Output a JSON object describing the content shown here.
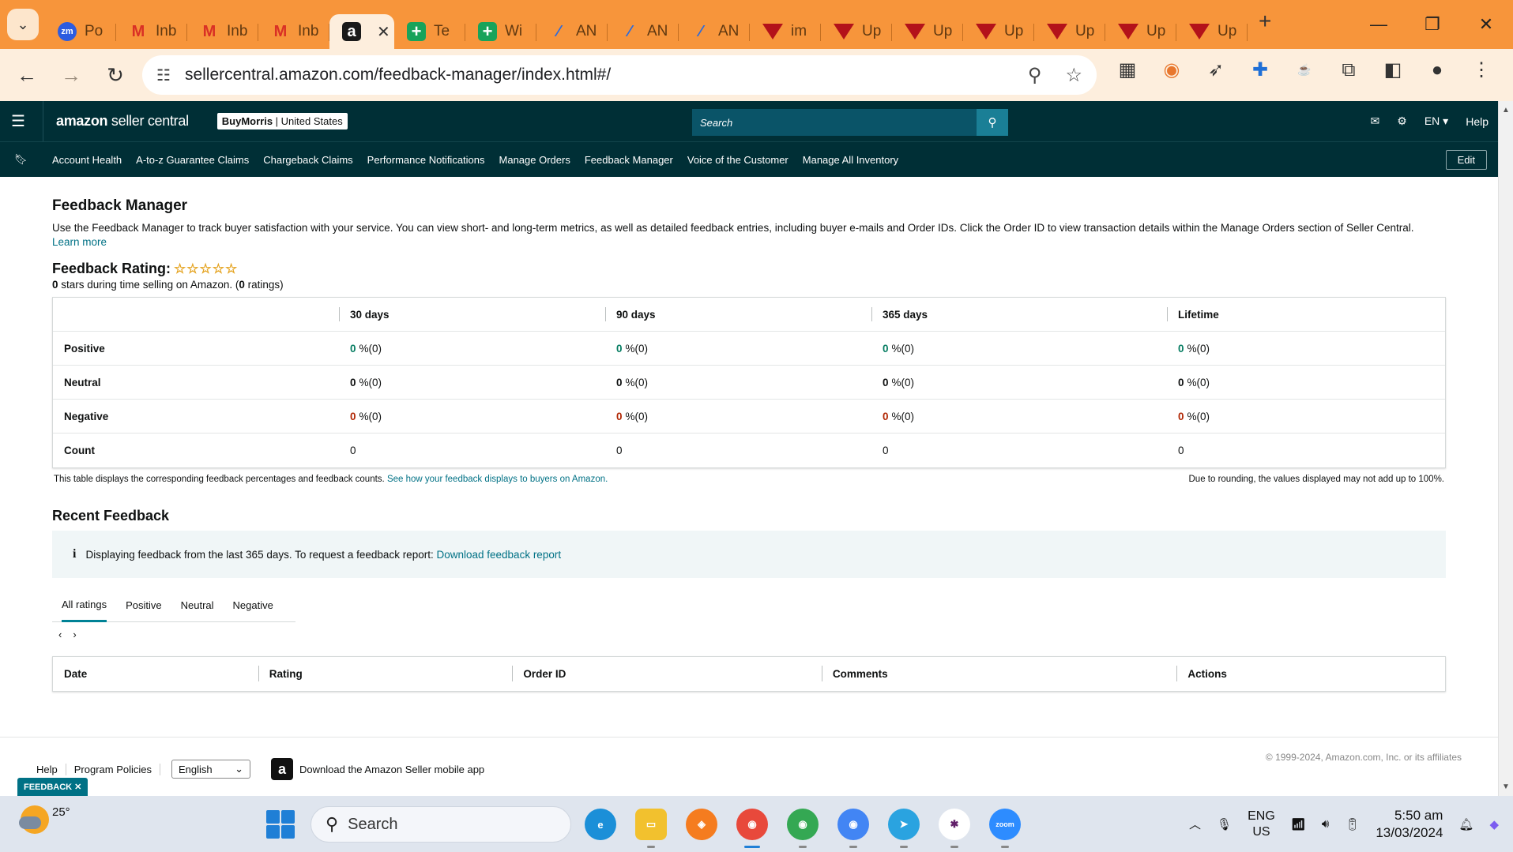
{
  "browser": {
    "tabs": [
      {
        "icon": "zoom-favicon-icon",
        "label": "Po"
      },
      {
        "icon": "gmail-favicon-icon",
        "label": "Inb"
      },
      {
        "icon": "gmail-favicon-icon",
        "label": "Inb"
      },
      {
        "icon": "gmail-favicon-icon",
        "label": "Inb"
      },
      {
        "icon": "amazon-favicon-icon",
        "label": "",
        "active": true
      },
      {
        "icon": "sheets-favicon-icon",
        "label": "Te"
      },
      {
        "icon": "sheets-favicon-icon",
        "label": "Wi"
      },
      {
        "icon": "am-favicon-icon",
        "label": "AN"
      },
      {
        "icon": "am-favicon-icon",
        "label": "AN"
      },
      {
        "icon": "am-favicon-icon",
        "label": "AN"
      },
      {
        "icon": "red-triangle-favicon-icon",
        "label": "im"
      },
      {
        "icon": "red-triangle-favicon-icon",
        "label": "Up"
      },
      {
        "icon": "red-triangle-favicon-icon",
        "label": "Up"
      },
      {
        "icon": "red-triangle-favicon-icon",
        "label": "Up"
      },
      {
        "icon": "red-triangle-favicon-icon",
        "label": "Up"
      },
      {
        "icon": "red-triangle-favicon-icon",
        "label": "Up"
      },
      {
        "icon": "red-triangle-favicon-icon",
        "label": "Up"
      }
    ],
    "url": "sellercentral.amazon.com/feedback-manager/index.html#/",
    "colors": {
      "tab_strip": "#f7953b",
      "toolbar": "#fdeedd"
    }
  },
  "header": {
    "logo_brand": "amazon",
    "logo_suffix": "seller central",
    "store_name": "BuyMorris",
    "store_region": "United States",
    "search_placeholder": "Search",
    "language": "EN",
    "help": "Help",
    "colors": {
      "bg": "#002f36",
      "search": "#0a5468"
    }
  },
  "nav": {
    "items": [
      "Account Health",
      "A-to-z Guarantee Claims",
      "Chargeback Claims",
      "Performance Notifications",
      "Manage Orders",
      "Feedback Manager",
      "Voice of the Customer",
      "Manage All Inventory"
    ],
    "edit": "Edit"
  },
  "page": {
    "title": "Feedback Manager",
    "intro": "Use the Feedback Manager to track buyer satisfaction with your service. You can view short- and long-term metrics, as well as detailed feedback entries, including buyer e-mails and Order IDs. Click the Order ID to view transaction details within the Manage Orders section of Seller Central.",
    "learn_more": "Learn more",
    "rating_label": "Feedback Rating:",
    "rating_stars": 0,
    "rating_stars_max": 5,
    "rating_sub_stars": "0",
    "rating_sub_mid": " stars during time selling on Amazon. (",
    "rating_sub_count": "0",
    "rating_sub_end": " ratings)"
  },
  "metrics": {
    "columns": [
      "30 days",
      "90 days",
      "365 days",
      "Lifetime"
    ],
    "rows": [
      {
        "label": "Positive",
        "values": [
          "0",
          "0",
          "0",
          "0"
        ],
        "suffix": " %(0)"
      },
      {
        "label": "Neutral",
        "values": [
          "0",
          "0",
          "0",
          "0"
        ],
        "suffix": " %(0)"
      },
      {
        "label": "Negative",
        "values": [
          "0",
          "0",
          "0",
          "0"
        ],
        "suffix": " %(0)"
      },
      {
        "label": "Count",
        "values": [
          "0",
          "0",
          "0",
          "0"
        ],
        "suffix": ""
      }
    ],
    "note_left": "This table displays the corresponding feedback percentages and feedback counts.",
    "note_link": "See how your feedback displays to buyers on Amazon.",
    "note_right": "Due to rounding, the values displayed may not add up to 100%.",
    "colors": {
      "positive": "#067d62",
      "negative": "#b12704"
    }
  },
  "recent": {
    "title": "Recent Feedback",
    "info_icon": "i",
    "info_text": "Displaying feedback from the last 365 days. To request a feedback report:",
    "info_link": "Download feedback report",
    "tabs": [
      "All ratings",
      "Positive",
      "Neutral",
      "Negative"
    ],
    "active_tab": "All ratings",
    "prev": "‹",
    "next": "›",
    "columns": [
      "Date",
      "Rating",
      "Order ID",
      "Comments",
      "Actions"
    ]
  },
  "footer": {
    "links": [
      "Help",
      "Program Policies"
    ],
    "language": "English",
    "app_text": "Download the Amazon Seller mobile app",
    "copyright": "© 1999-2024, Amazon.com, Inc. or its affiliates",
    "feedback_tab": "FEEDBACK ✕"
  },
  "taskbar": {
    "temperature": "25°",
    "search": "Search",
    "lang_1": "ENG",
    "lang_2": "US",
    "time": "5:50 am",
    "date": "13/03/2024"
  }
}
